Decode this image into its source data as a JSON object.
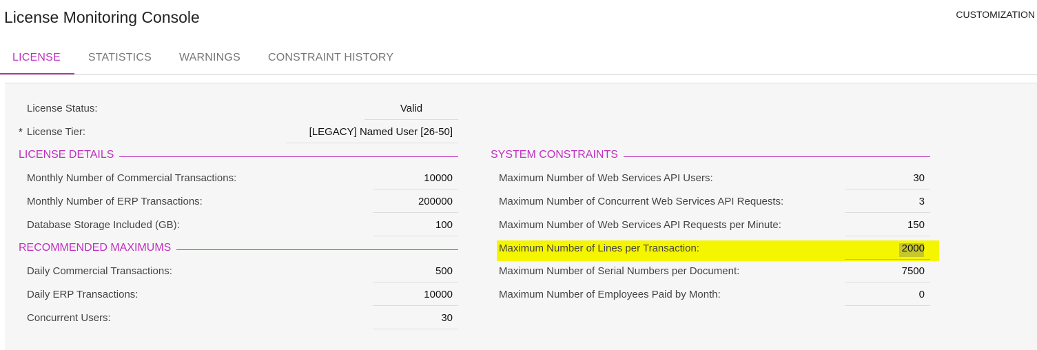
{
  "app": {
    "title": "License Monitoring Console",
    "customization_label": "CUSTOMIZATION"
  },
  "tabs": [
    {
      "label": "LICENSE",
      "active": true
    },
    {
      "label": "STATISTICS",
      "active": false
    },
    {
      "label": "WARNINGS",
      "active": false
    },
    {
      "label": "CONSTRAINT HISTORY",
      "active": false
    }
  ],
  "license": {
    "status_label": "License Status:",
    "status_value": "Valid",
    "tier_required_mark": "*",
    "tier_label": "License Tier:",
    "tier_value": "[LEGACY] Named User [26-50]"
  },
  "license_details": {
    "title": "LICENSE DETAILS",
    "rows": [
      {
        "label": "Monthly Number of Commercial Transactions:",
        "value": "10000"
      },
      {
        "label": "Monthly Number of ERP Transactions:",
        "value": "200000"
      },
      {
        "label": "Database Storage Included (GB):",
        "value": "100"
      }
    ]
  },
  "recommended_maximums": {
    "title": "RECOMMENDED MAXIMUMS",
    "rows": [
      {
        "label": "Daily Commercial Transactions:",
        "value": "500"
      },
      {
        "label": "Daily ERP Transactions:",
        "value": "10000"
      },
      {
        "label": "Concurrent Users:",
        "value": "30"
      }
    ]
  },
  "system_constraints": {
    "title": "SYSTEM CONSTRAINTS",
    "rows": [
      {
        "label": "Maximum Number of Web Services API Users:",
        "value": "30"
      },
      {
        "label": "Maximum Number of Concurrent Web Services API Requests:",
        "value": "3"
      },
      {
        "label": "Maximum Number of Web Services API Requests per Minute:",
        "value": "150"
      },
      {
        "label": "Maximum Number of Lines per Transaction:",
        "value": "2000",
        "highlighted": true
      },
      {
        "label": "Maximum Number of Serial Numbers per Document:",
        "value": "7500"
      },
      {
        "label": "Maximum Number of Employees Paid by Month:",
        "value": "0"
      }
    ]
  },
  "colors": {
    "accent": "#c02fc0",
    "highlight": "#f5f500",
    "content_bg": "#f6f6f6"
  }
}
